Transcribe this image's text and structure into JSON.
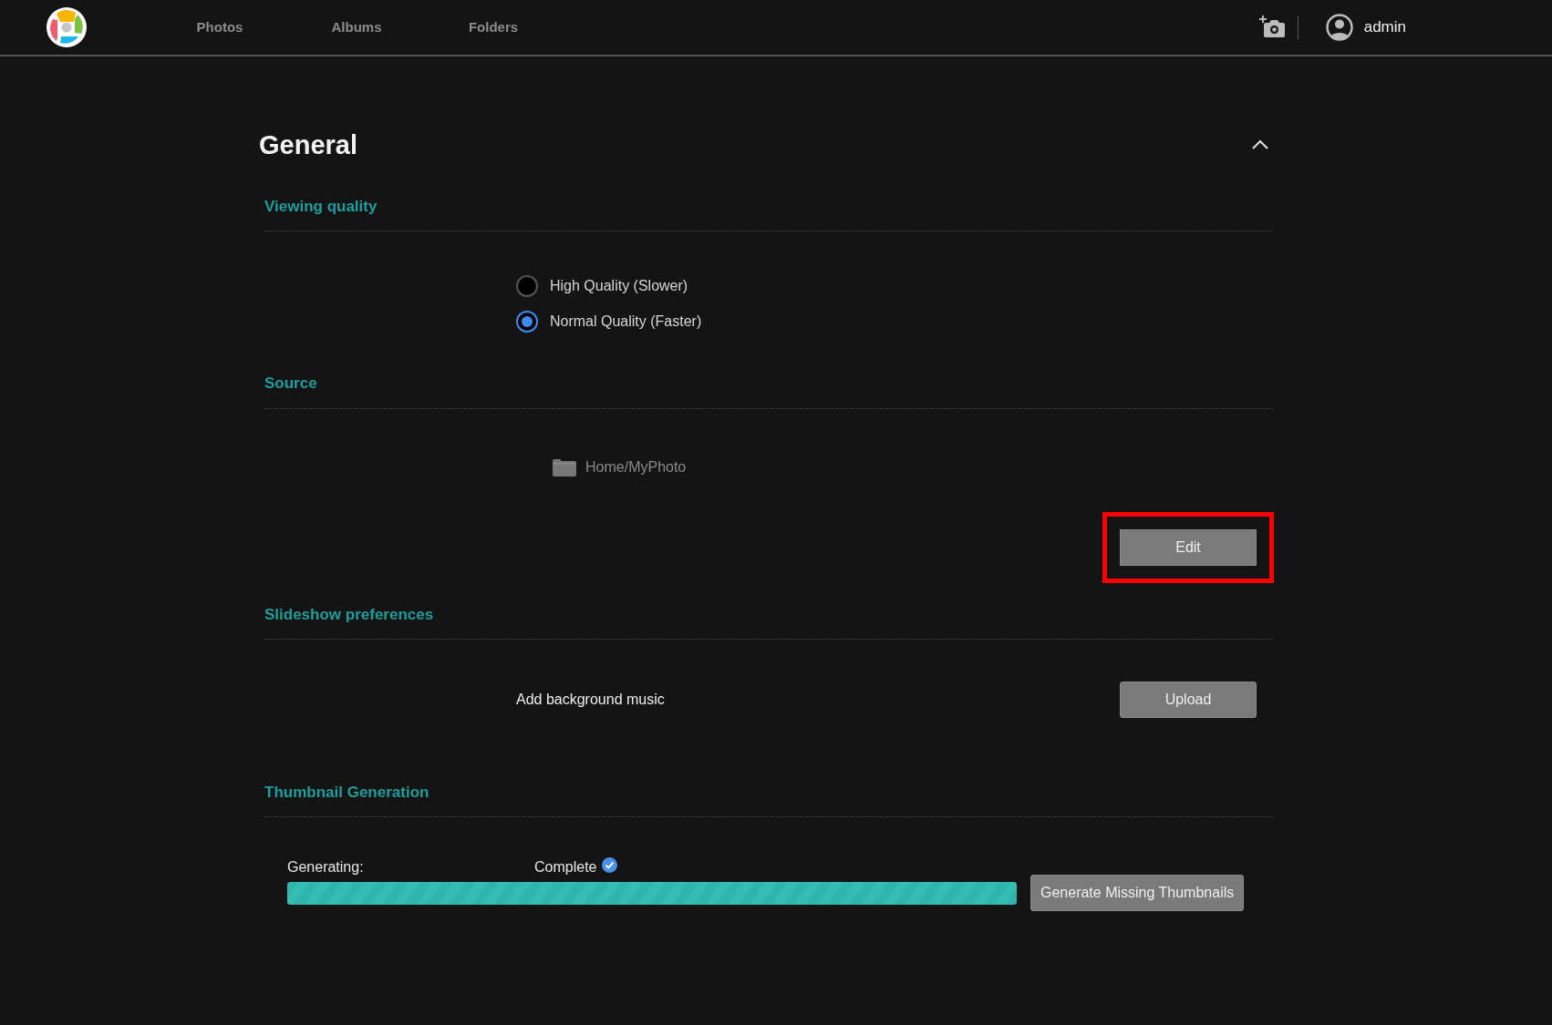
{
  "nav": {
    "items": [
      {
        "label": "Photos",
        "selected": false
      },
      {
        "label": "Albums",
        "selected": false
      },
      {
        "label": "Folders",
        "selected": false
      }
    ],
    "user": "admin"
  },
  "section": {
    "title": "General",
    "expanded": true
  },
  "viewing_quality": {
    "heading": "Viewing quality",
    "options": [
      {
        "label": "High Quality (Slower)",
        "selected": false
      },
      {
        "label": "Normal Quality (Faster)",
        "selected": true
      }
    ]
  },
  "source": {
    "heading": "Source",
    "folder": "Home/MyPhoto",
    "edit_button": {
      "label": "Edit",
      "highlighted": true
    }
  },
  "slideshow": {
    "heading": "Slideshow preferences",
    "label": "Add background music",
    "button": "Upload"
  },
  "thumbnails": {
    "heading": "Thumbnail Generation",
    "status_label": "Generating:",
    "status": "Complete",
    "complete": true,
    "level": 1,
    "button": "Generate Missing Thumbnails"
  }
}
